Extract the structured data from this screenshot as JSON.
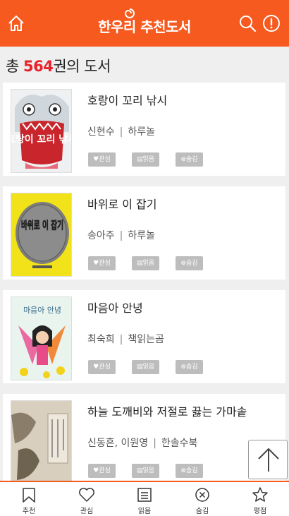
{
  "header": {
    "title": "한우리 추천도서",
    "home_icon": "home-icon",
    "search_icon": "search-icon",
    "info_icon": "info-icon",
    "accent": "#f65a1f"
  },
  "summary": {
    "prefix": "총 ",
    "count": "564",
    "suffix": "권의 도서"
  },
  "books": [
    {
      "title": "호랑이 꼬리 낚시",
      "author": "신현수",
      "publisher": "하루놀",
      "tags": [
        "관심",
        "읽음",
        "숨김"
      ]
    },
    {
      "title": "바위로 이 잡기",
      "author": "송아주",
      "publisher": "하루놀",
      "tags": [
        "관심",
        "읽음",
        "숨김"
      ]
    },
    {
      "title": "마음아 안녕",
      "author": "최숙희",
      "publisher": "책읽는곰",
      "tags": [
        "관심",
        "읽음",
        "숨김"
      ]
    },
    {
      "title": "하늘 도깨비와 저절로 끓는 가마솥",
      "author": "신동흔, 이원영",
      "publisher": "한솔수북",
      "tags": [
        "관심",
        "읽음",
        "숨김"
      ]
    }
  ],
  "cover_text": {
    "book1": "호랑이 꼬리 낚시",
    "book2": "바위로 이 잡기",
    "book3": "마음아 안녕"
  },
  "tabs": [
    {
      "label": "추천",
      "icon": "bookmark-icon"
    },
    {
      "label": "관심",
      "icon": "heart-icon"
    },
    {
      "label": "읽음",
      "icon": "list-icon"
    },
    {
      "label": "숨김",
      "icon": "x-circle-icon"
    },
    {
      "label": "평점",
      "icon": "star-icon"
    }
  ]
}
